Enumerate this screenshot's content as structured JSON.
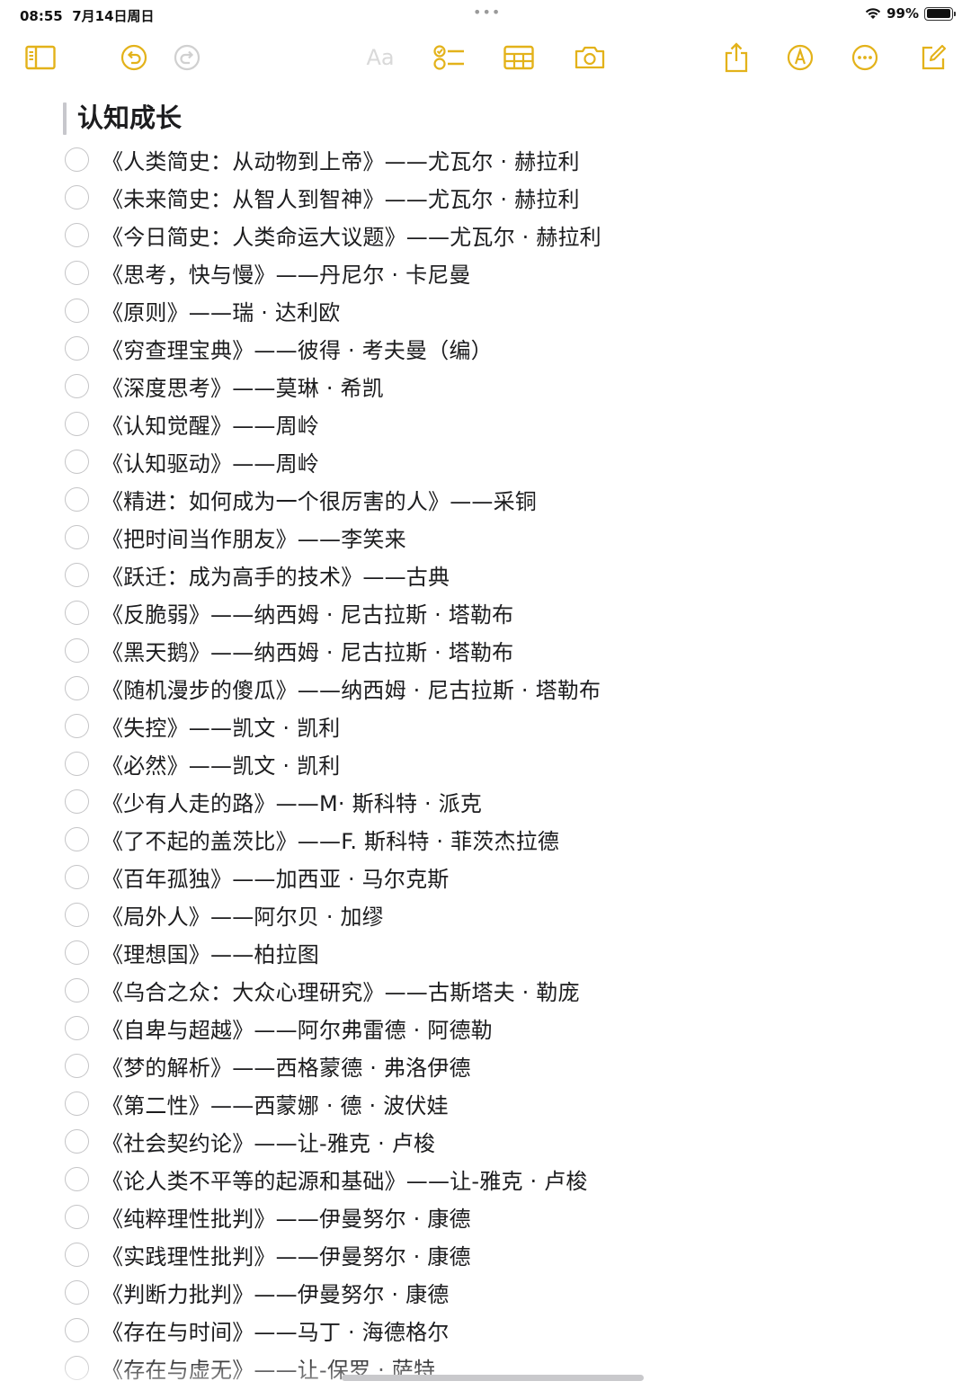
{
  "status_bar": {
    "time": "08:55",
    "date": "7月14日周日",
    "battery_text": "99%",
    "battery_level": 0.99,
    "dots": "•••"
  },
  "toolbar": {
    "accent_color": "#e3b21a",
    "disabled_color": "#d9d9d9",
    "icons": [
      "sidebar-icon",
      "undo-icon",
      "redo-icon",
      "format-text-icon",
      "checklist-icon",
      "table-icon",
      "camera-icon",
      "share-icon",
      "markup-icon",
      "more-icon",
      "compose-icon"
    ],
    "format_label": "Aa"
  },
  "note": {
    "title": "认知成长",
    "items": [
      "《人类简史：从动物到上帝》——尤瓦尔 · 赫拉利",
      "《未来简史：从智人到智神》——尤瓦尔 · 赫拉利",
      "《今日简史：人类命运大议题》——尤瓦尔 · 赫拉利",
      "《思考，快与慢》——丹尼尔 · 卡尼曼",
      "《原则》——瑞 · 达利欧",
      "《穷查理宝典》——彼得 · 考夫曼（编）",
      "《深度思考》——莫琳 · 希凯",
      "《认知觉醒》——周岭",
      "《认知驱动》——周岭",
      "《精进：如何成为一个很厉害的人》——采铜",
      "《把时间当作朋友》——李笑来",
      "《跃迁：成为高手的技术》——古典",
      "《反脆弱》——纳西姆 · 尼古拉斯 · 塔勒布",
      "《黑天鹅》——纳西姆 · 尼古拉斯 · 塔勒布",
      "《随机漫步的傻瓜》——纳西姆 · 尼古拉斯 · 塔勒布",
      "《失控》——凯文 · 凯利",
      "《必然》——凯文 · 凯利",
      "《少有人走的路》——M· 斯科特 · 派克",
      "《了不起的盖茨比》——F. 斯科特 · 菲茨杰拉德",
      "《百年孤独》——加西亚 · 马尔克斯",
      "《局外人》——阿尔贝 · 加缪",
      "《理想国》——柏拉图",
      "《乌合之众：大众心理研究》——古斯塔夫 · 勒庞",
      "《自卑与超越》——阿尔弗雷德 · 阿德勒",
      "《梦的解析》——西格蒙德 · 弗洛伊德",
      "《第二性》——西蒙娜 · 德 · 波伏娃",
      "《社会契约论》——让-雅克 · 卢梭",
      "《论人类不平等的起源和基础》——让-雅克 · 卢梭",
      "《纯粹理性批判》——伊曼努尔 · 康德",
      "《实践理性批判》——伊曼努尔 · 康德",
      "《判断力批判》——伊曼努尔 · 康德",
      "《存在与时间》——马丁 · 海德格尔",
      "《存在与虚无》——让-保罗 · 萨特"
    ]
  }
}
